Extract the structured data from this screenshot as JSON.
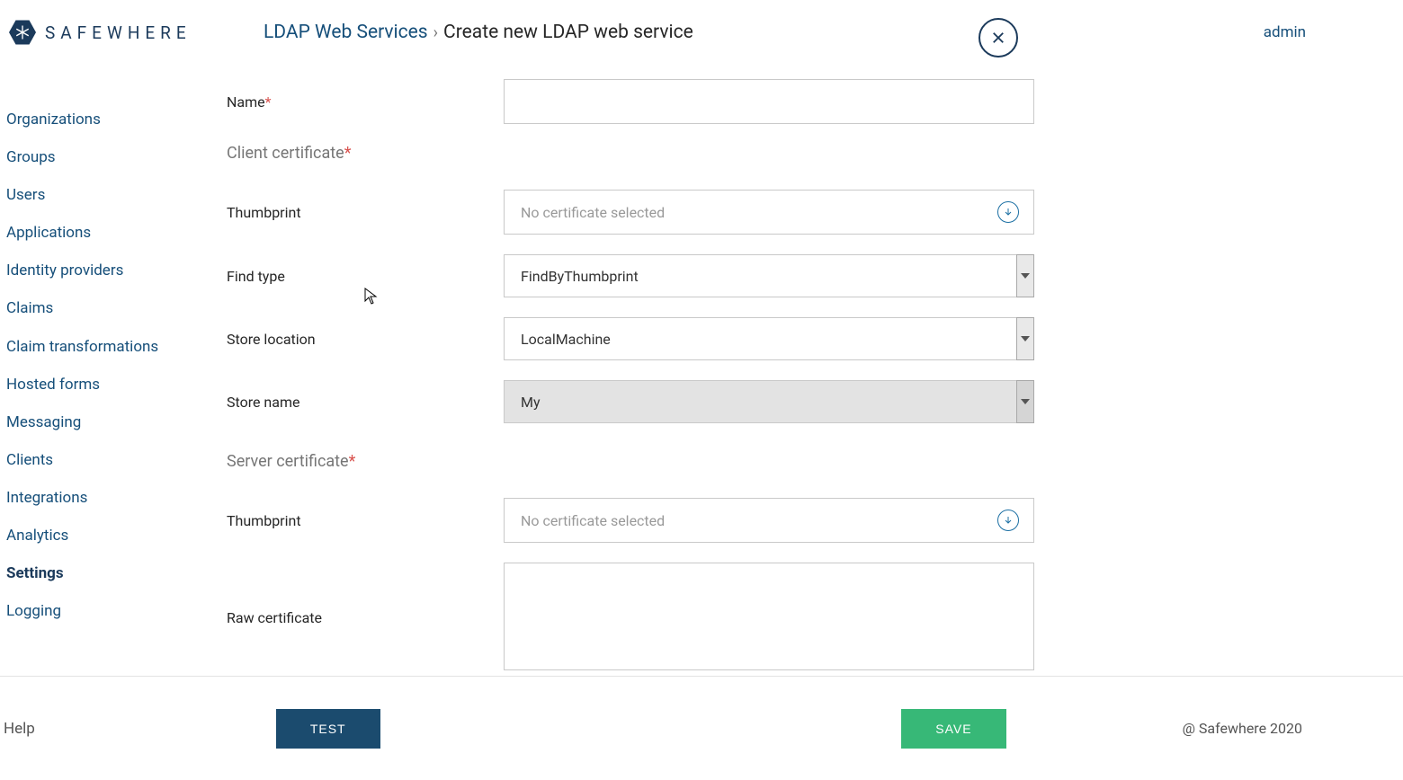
{
  "brand": {
    "name": "SAFEWHERE"
  },
  "header": {
    "breadcrumb_link": "LDAP Web Services",
    "breadcrumb_sep": "›",
    "breadcrumb_current": "Create new LDAP web service",
    "user": "admin"
  },
  "sidebar": {
    "items": [
      {
        "label": "Organizations"
      },
      {
        "label": "Groups"
      },
      {
        "label": "Users"
      },
      {
        "label": "Applications"
      },
      {
        "label": "Identity providers"
      },
      {
        "label": "Claims"
      },
      {
        "label": "Claim transformations"
      },
      {
        "label": "Hosted forms"
      },
      {
        "label": "Messaging"
      },
      {
        "label": "Clients"
      },
      {
        "label": "Integrations"
      },
      {
        "label": "Analytics"
      },
      {
        "label": "Settings"
      },
      {
        "label": "Logging"
      }
    ],
    "active_index": 12
  },
  "form": {
    "name_label": "Name",
    "name_value": "",
    "client_cert_section": "Client certificate",
    "thumbprint_label": "Thumbprint",
    "cert_placeholder": "No certificate selected",
    "find_type_label": "Find type",
    "find_type_value": "FindByThumbprint",
    "store_location_label": "Store location",
    "store_location_value": "LocalMachine",
    "store_name_label": "Store name",
    "store_name_value": "My",
    "server_cert_section": "Server certificate",
    "server_thumbprint_label": "Thumbprint",
    "raw_cert_label": "Raw certificate",
    "raw_cert_value": ""
  },
  "footer": {
    "help": "Help",
    "test": "TEST",
    "save": "SAVE",
    "copyright": "@ Safewhere 2020"
  }
}
